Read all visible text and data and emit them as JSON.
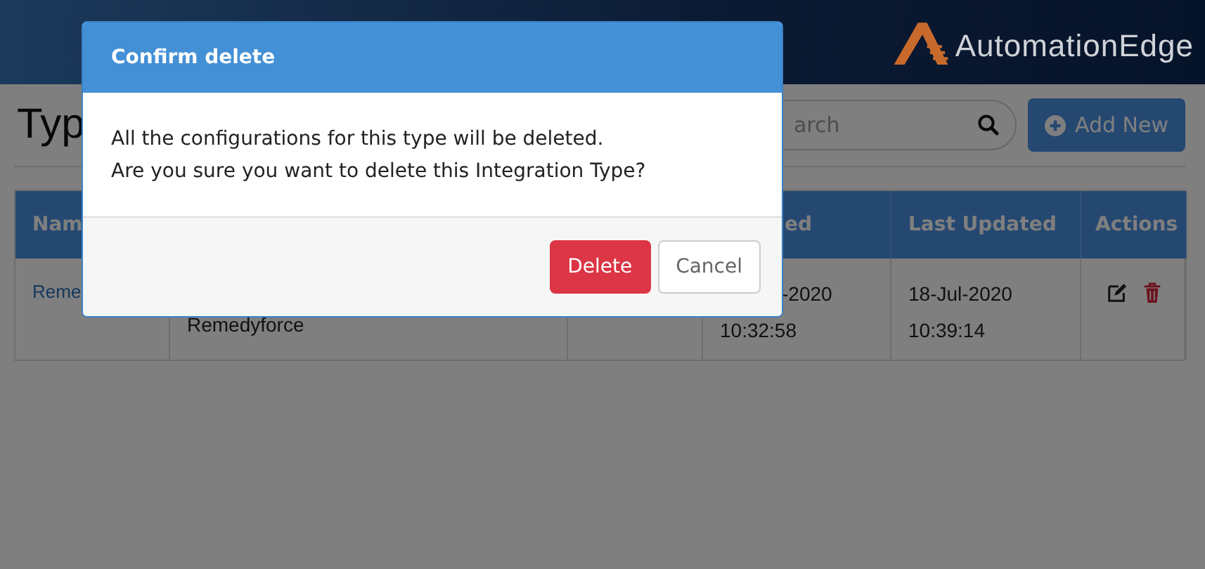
{
  "header": {
    "logo_text": "AutomationEdge"
  },
  "page": {
    "title": "Typ",
    "search": {
      "placeholder": "arch"
    },
    "add_button": "Add New"
  },
  "table": {
    "columns": [
      "Nam",
      "ed",
      "Last Updated",
      "Actions"
    ],
    "rows": [
      {
        "name": "Reme",
        "column_2": "Remedyforce",
        "created": [
          "-2020",
          "10:32:58"
        ],
        "updated": [
          "18-Jul-2020",
          "10:39:14"
        ]
      }
    ]
  },
  "dialog": {
    "title": "Confirm delete",
    "message": [
      "All the configurations for this type will be deleted.",
      "Are you sure you want to delete this Integration Type?"
    ],
    "buttons": [
      {
        "label": "Delete",
        "kind": "danger"
      },
      {
        "label": "Cancel",
        "kind": "default"
      }
    ]
  }
}
